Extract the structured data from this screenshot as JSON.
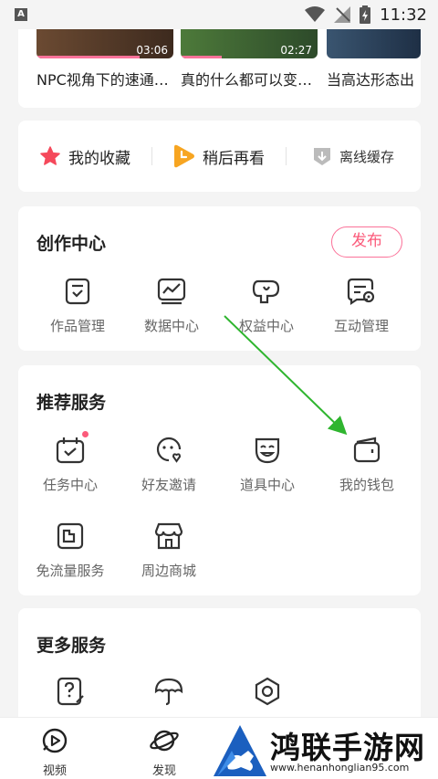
{
  "status_bar": {
    "time": "11:32",
    "notification_letter": "A"
  },
  "videos": [
    {
      "duration": "03:06",
      "title": "NPC视角下的速通…",
      "progress": 0.75,
      "thumb_colors": [
        "#6b4a32",
        "#3d2a1e"
      ]
    },
    {
      "duration": "02:27",
      "title": "真的什么都可以变…",
      "progress": 0.3,
      "thumb_colors": [
        "#4d7a3a",
        "#2d4a2a"
      ]
    },
    {
      "duration": "",
      "title": "当高达形态出",
      "progress": 0,
      "thumb_colors": [
        "#3a5570",
        "#1e2f45"
      ]
    }
  ],
  "quick_actions": [
    {
      "label": "我的收藏",
      "icon": "star-icon",
      "color": "#f5495b"
    },
    {
      "label": "稍后再看",
      "icon": "watch-later-icon",
      "color": "#f7a521"
    },
    {
      "label": "离线缓存",
      "icon": "download-icon",
      "color": "#999999"
    }
  ],
  "creation": {
    "title": "创作中心",
    "publish_label": "发布",
    "items": [
      {
        "label": "作品管理",
        "icon": "works-icon"
      },
      {
        "label": "数据中心",
        "icon": "data-chart-icon"
      },
      {
        "label": "权益中心",
        "icon": "rights-icon"
      },
      {
        "label": "互动管理",
        "icon": "interaction-icon"
      }
    ]
  },
  "recommended": {
    "title": "推荐服务",
    "items": [
      {
        "label": "任务中心",
        "icon": "calendar-icon",
        "badge": true
      },
      {
        "label": "好友邀请",
        "icon": "invite-friend-icon",
        "badge": false
      },
      {
        "label": "道具中心",
        "icon": "mask-icon",
        "badge": false
      },
      {
        "label": "我的钱包",
        "icon": "wallet-icon",
        "badge": false
      },
      {
        "label": "免流量服务",
        "icon": "sim-card-icon",
        "badge": false
      },
      {
        "label": "周边商城",
        "icon": "shop-icon",
        "badge": false
      }
    ]
  },
  "more": {
    "title": "更多服务",
    "items": [
      {
        "label": "",
        "icon": "help-icon"
      },
      {
        "label": "",
        "icon": "umbrella-icon"
      },
      {
        "label": "",
        "icon": "settings-icon"
      }
    ]
  },
  "bottom_nav": [
    {
      "label": "视频",
      "icon": "video-icon"
    },
    {
      "label": "发现",
      "icon": "planet-icon"
    }
  ],
  "watermark": {
    "text": "鸿联手游网",
    "url": "www.henanhonglian95.com"
  },
  "colors": {
    "accent": "#fb7299",
    "arrow": "#2fb52f"
  }
}
